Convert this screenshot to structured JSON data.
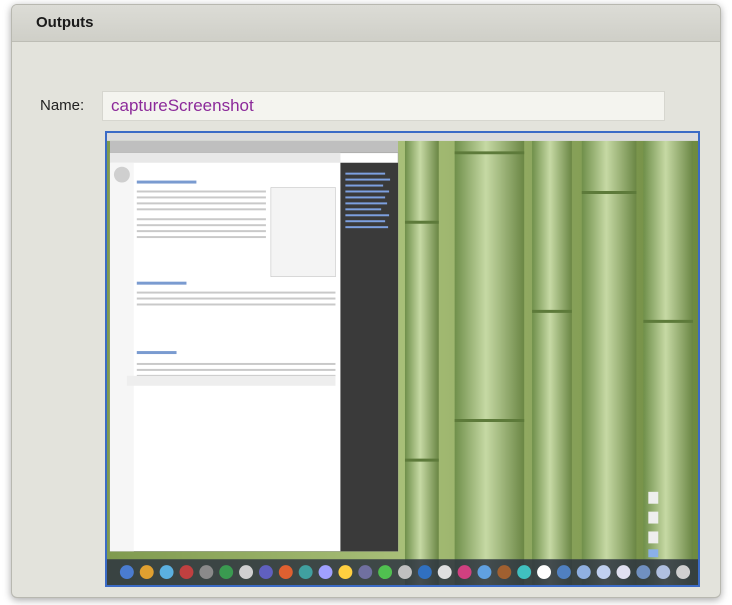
{
  "section": {
    "title": "Outputs"
  },
  "name_field": {
    "label": "Name:",
    "value": "captureScreenshot"
  },
  "preview": {
    "alt": "captured desktop screenshot"
  },
  "colors": {
    "value_text": "#8c2a9a",
    "preview_border": "#3b6bc6"
  }
}
